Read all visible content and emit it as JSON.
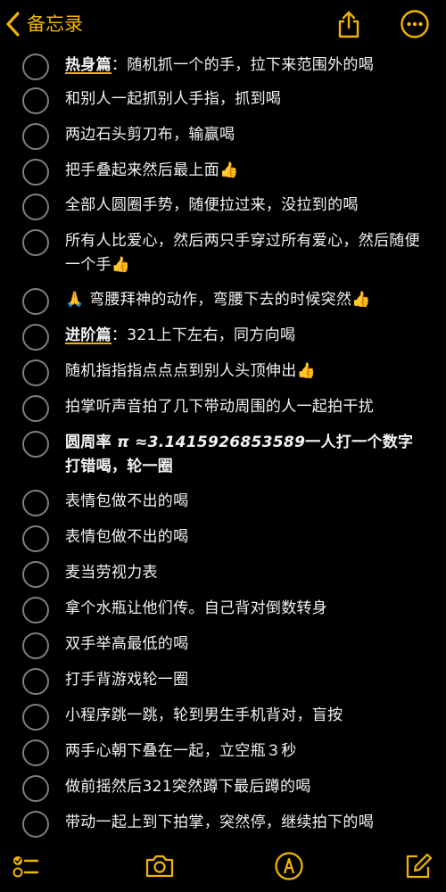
{
  "header": {
    "back_label": "备忘录"
  },
  "emoji": {
    "thumbs": "👍",
    "pray": "🙏"
  },
  "items": [
    {
      "prefix": "热身篇",
      "text": "：随机抓一个的手，拉下来范围外的喝"
    },
    {
      "text": "和别人一起抓别人手指，抓到喝"
    },
    {
      "text": "两边石头剪刀布，输赢喝"
    },
    {
      "text": "把手叠起来然后最上面"
    },
    {
      "text": "全部人圆圈手势，随便拉过来，没拉到的喝"
    },
    {
      "text": "所有人比爱心，然后两只手穿过所有爱心，然后随便一个手"
    },
    {
      "text": "弯腰拜神的动作，弯腰下去的时候突然"
    },
    {
      "prefix": "进阶篇",
      "text": "：321上下左右，同方向喝"
    },
    {
      "text": "随机指指指点点点到别人头顶伸出"
    },
    {
      "text": "拍掌听声音拍了几下带动周围的人一起拍干扰"
    },
    {
      "text_a": "圆周率 ",
      "text_b": "π ≈3.1415926853589",
      "text_c": "一人打一个数字打错喝，轮一圈"
    },
    {
      "text": "表情包做不出的喝"
    },
    {
      "text": "表情包做不出的喝"
    },
    {
      "text": "麦当劳视力表"
    },
    {
      "text": "拿个水瓶让他们传。自己背对倒数转身"
    },
    {
      "text": "双手举高最低的喝"
    },
    {
      "text": "打手背游戏轮一圈"
    },
    {
      "text": "小程序跳一跳，轮到男生手机背对，盲按"
    },
    {
      "text": "两手心朝下叠在一起，立空瓶３秒"
    },
    {
      "text": "做前摇然后321突然蹲下最后蹲的喝"
    },
    {
      "text": "带动一起上到下拍掌，突然停，继续拍下的喝"
    }
  ],
  "toolbar": {
    "checklist": "checklist-icon",
    "camera": "camera-icon",
    "markup": "markup-icon",
    "compose": "compose-icon"
  },
  "colors": {
    "accent": "#f0b400",
    "background": "#000000",
    "text": "#f2f2f2",
    "checkbox": "#7e7e7e"
  }
}
